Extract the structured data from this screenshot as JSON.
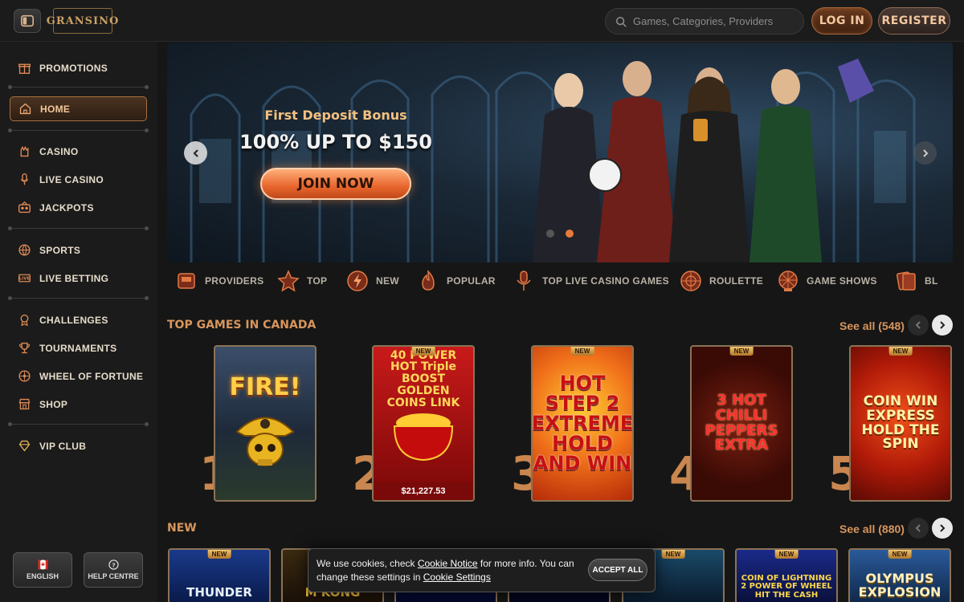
{
  "header": {
    "logo_text": "GRANSINO",
    "search_placeholder": "Games, Categories, Providers",
    "login_label": "LOG IN",
    "register_label": "REGISTER"
  },
  "sidebar": {
    "items": [
      {
        "label": "PROMOTIONS",
        "icon": "gift-icon"
      },
      {
        "label": "HOME",
        "icon": "home-icon",
        "active": true
      },
      {
        "label": "CASINO",
        "icon": "casino-hand-icon"
      },
      {
        "label": "LIVE CASINO",
        "icon": "microphone-icon"
      },
      {
        "label": "JACKPOTS",
        "icon": "jackpot-icon"
      },
      {
        "label": "SPORTS",
        "icon": "basketball-icon"
      },
      {
        "label": "LIVE BETTING",
        "icon": "live-icon"
      },
      {
        "label": "CHALLENGES",
        "icon": "medal-icon"
      },
      {
        "label": "TOURNAMENTS",
        "icon": "trophy-icon"
      },
      {
        "label": "WHEEL OF FORTUNE",
        "icon": "wheel-icon"
      },
      {
        "label": "SHOP",
        "icon": "shop-icon"
      },
      {
        "label": "VIP CLUB",
        "icon": "diamond-icon"
      }
    ],
    "language_label": "ENGLISH",
    "help_label": "HELP CENTRE"
  },
  "banner": {
    "subtitle": "First Deposit Bonus",
    "title": "100% UP TO $150",
    "cta": "JOIN NOW"
  },
  "categories": [
    {
      "label": "PROVIDERS",
      "icon": "providers-icon"
    },
    {
      "label": "TOP",
      "icon": "star-icon"
    },
    {
      "label": "NEW",
      "icon": "lightning-icon"
    },
    {
      "label": "POPULAR",
      "icon": "fire-icon"
    },
    {
      "label": "TOP LIVE CASINO GAMES",
      "icon": "live-mic-icon"
    },
    {
      "label": "ROULETTE",
      "icon": "roulette-icon"
    },
    {
      "label": "GAME SHOWS",
      "icon": "game-show-icon"
    },
    {
      "label": "BL",
      "icon": "blackjack-icon"
    }
  ],
  "top_games": {
    "title": "TOP GAMES IN CANADA",
    "see_all": "See all (548)",
    "games": [
      {
        "rank": "1",
        "name": "FIRE!",
        "badge": ""
      },
      {
        "rank": "2",
        "name": "40 POWER HOT Triple BOOST GOLDEN COINS LINK",
        "badge": "NEW",
        "jackpot": "$21,227.53"
      },
      {
        "rank": "3",
        "name": "HOT STEP 2 EXTREME HOLD AND WIN",
        "badge": "NEW"
      },
      {
        "rank": "4",
        "name": "3 HOT CHILLI PEPPERS EXTRA",
        "badge": "NEW"
      },
      {
        "rank": "5",
        "name": "COIN WIN EXPRESS HOLD THE SPIN",
        "badge": "NEW"
      }
    ]
  },
  "new_games": {
    "title": "NEW",
    "see_all": "See all (880)",
    "games": [
      {
        "name": "THUNDER",
        "badge": "NEW"
      },
      {
        "name": "M KONG",
        "badge": ""
      },
      {
        "name": "",
        "badge": ""
      },
      {
        "name": "",
        "badge": ""
      },
      {
        "name": "",
        "badge": "NEW"
      },
      {
        "name": "COIN OF LIGHTNING 2 POWER OF WHEEL HIT THE CASH",
        "badge": "NEW"
      },
      {
        "name": "OLYMPUS EXPLOSION",
        "badge": "NEW"
      }
    ]
  },
  "cookie": {
    "text_1": "We use cookies, check ",
    "link_1": "Cookie Notice",
    "text_2": " for more info. You can change these settings in ",
    "link_2": "Cookie Settings",
    "accept_label": "ACCEPT ALL"
  },
  "colors": {
    "accent": "#d8965c",
    "bg": "#161616",
    "sidebar_bg": "#1b1b1b"
  }
}
